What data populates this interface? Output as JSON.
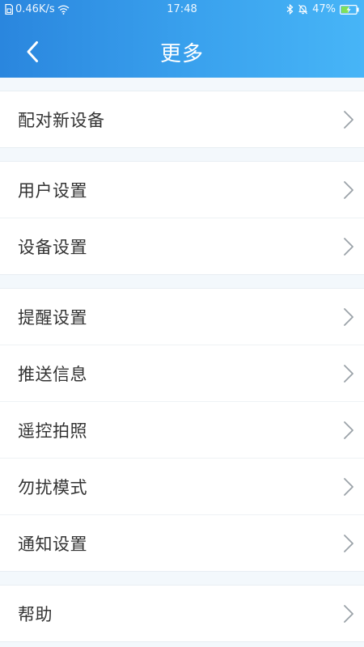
{
  "status_bar": {
    "network_speed": "0.46K/s",
    "time": "17:48",
    "battery": "47%"
  },
  "header": {
    "title": "更多"
  },
  "menu_groups": [
    {
      "items": [
        {
          "label": "配对新设备"
        }
      ]
    },
    {
      "items": [
        {
          "label": "用户设置"
        },
        {
          "label": "设备设置"
        }
      ]
    },
    {
      "items": [
        {
          "label": "提醒设置"
        },
        {
          "label": "推送信息"
        },
        {
          "label": "遥控拍照"
        },
        {
          "label": "勿扰模式"
        },
        {
          "label": "通知设置"
        }
      ]
    },
    {
      "items": [
        {
          "label": "帮助"
        }
      ]
    }
  ],
  "colors": {
    "header_start": "#2a86de",
    "header_end": "#47b5f7",
    "page_background": "#f3f8fc"
  }
}
